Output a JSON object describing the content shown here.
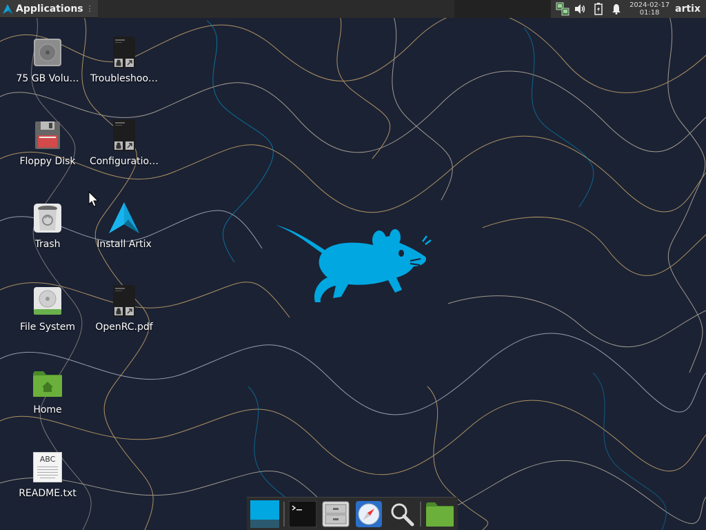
{
  "top_panel": {
    "applications_label": "Applications",
    "menu_indicator": "⋮",
    "clock_date": "2024-02-17",
    "clock_time": "01:18",
    "username": "artix"
  },
  "desktop_icons": [
    {
      "label": "75 GB Volu…",
      "icon": "drive-harddisk-icon"
    },
    {
      "label": "Troubleshoo…",
      "icon": "document-shortcut-icon"
    },
    {
      "label": "Floppy Disk",
      "icon": "floppy-disk-icon"
    },
    {
      "label": "Configuratio…",
      "icon": "document-shortcut-icon"
    },
    {
      "label": "Trash",
      "icon": "trash-icon"
    },
    {
      "label": "Install Artix",
      "icon": "artix-logo-icon"
    },
    {
      "label": "File System",
      "icon": "filesystem-icon"
    },
    {
      "label": "OpenRC.pdf",
      "icon": "document-shortcut-icon"
    },
    {
      "label": "Home",
      "icon": "home-folder-icon"
    },
    {
      "label": "README.txt",
      "icon": "text-file-icon",
      "glyph_text": "ABC"
    }
  ],
  "dock": {
    "items": [
      "show-desktop-icon",
      "terminal-icon",
      "file-manager-icon",
      "web-browser-icon",
      "app-finder-icon",
      "folder-icon"
    ]
  },
  "colors": {
    "accent": "#00a7e1",
    "wallpaper": "#1a2033",
    "home_folder": "#5b9c33"
  }
}
